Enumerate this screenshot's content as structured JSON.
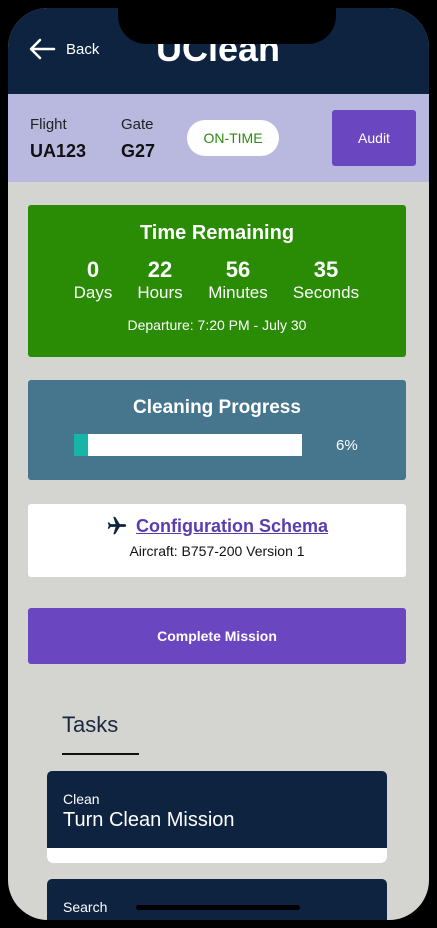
{
  "header": {
    "back_label": "Back",
    "app_title": "UClean"
  },
  "flight": {
    "flight_label": "Flight",
    "flight_value": "UA123",
    "gate_label": "Gate",
    "gate_value": "G27",
    "status": "ON-TIME",
    "audit_label": "Audit"
  },
  "countdown": {
    "title": "Time Remaining",
    "units": [
      {
        "value": "0",
        "label": "Days"
      },
      {
        "value": "22",
        "label": "Hours"
      },
      {
        "value": "56",
        "label": "Minutes"
      },
      {
        "value": "35",
        "label": "Seconds"
      }
    ],
    "departure": "Departure: 7:20 PM - July 30"
  },
  "progress": {
    "title": "Cleaning Progress",
    "percent_text": "6%",
    "fraction": 0.06
  },
  "config": {
    "icon": "airplane-icon",
    "link_label": "Configuration Schema",
    "aircraft": "Aircraft: B757-200 Version 1"
  },
  "actions": {
    "complete_label": "Complete Mission"
  },
  "tasks": {
    "tab_label": "Tasks",
    "items": [
      {
        "category": "Clean",
        "name": "Turn Clean Mission"
      },
      {
        "category": "Search",
        "name": ""
      }
    ]
  },
  "colors": {
    "header_bg": "#0d2340",
    "flight_bar_bg": "#b9b9e0",
    "accent_purple": "#6a47c0",
    "countdown_bg": "#2a8c05",
    "progress_bg": "#45768e",
    "progress_fill": "#17b5a8"
  }
}
